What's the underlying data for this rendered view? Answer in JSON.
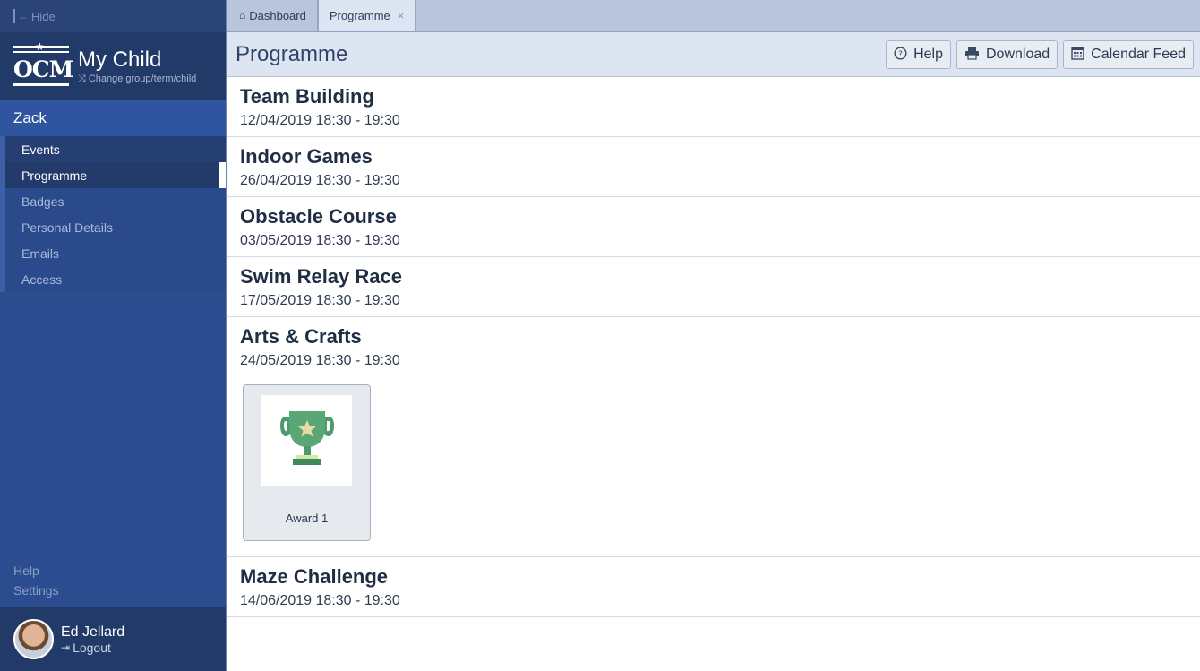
{
  "sidebar": {
    "hide_label": "Hide",
    "brand": {
      "logo_text": "OCM",
      "title": "My Child",
      "subtitle": "Change group/term/child"
    },
    "child_name": "Zack",
    "items": [
      {
        "label": "Events"
      },
      {
        "label": "Programme"
      },
      {
        "label": "Badges"
      },
      {
        "label": "Personal Details"
      },
      {
        "label": "Emails"
      },
      {
        "label": "Access"
      }
    ],
    "links": [
      {
        "label": "Help"
      },
      {
        "label": "Settings"
      }
    ],
    "user": {
      "name": "Ed Jellard",
      "logout": "Logout"
    }
  },
  "tabs": [
    {
      "label": "Dashboard"
    },
    {
      "label": "Programme"
    }
  ],
  "header": {
    "title": "Programme",
    "buttons": [
      {
        "label": "Help",
        "icon": "help-circle-icon"
      },
      {
        "label": "Download",
        "icon": "printer-icon"
      },
      {
        "label": "Calendar Feed",
        "icon": "calendar-icon"
      }
    ]
  },
  "events": [
    {
      "name": "Team Building",
      "date": "12/04/2019 18:30 - 19:30"
    },
    {
      "name": "Indoor Games",
      "date": "26/04/2019 18:30 - 19:30"
    },
    {
      "name": "Obstacle Course",
      "date": "03/05/2019 18:30 - 19:30"
    },
    {
      "name": "Swim Relay Race",
      "date": "17/05/2019 18:30 - 19:30"
    },
    {
      "name": "Arts & Crafts",
      "date": "24/05/2019 18:30 - 19:30",
      "award": {
        "label": "Award 1",
        "icon": "trophy-icon"
      }
    },
    {
      "name": "Maze Challenge",
      "date": "14/06/2019 18:30 - 19:30"
    }
  ],
  "colors": {
    "sidebar": "#2b4d8f",
    "trophy": "#4f9a6d",
    "trophy_star": "#e7dca8"
  }
}
